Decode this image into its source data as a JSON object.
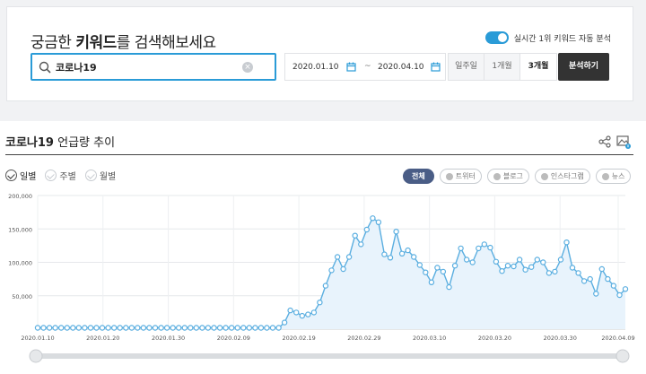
{
  "search": {
    "title_prefix": "궁금한 ",
    "title_bold": "키워드",
    "title_suffix": "를 검색해보세요",
    "keyword": "코로나19",
    "icon": "search-icon",
    "clear_icon": "close-icon"
  },
  "realtime_toggle": {
    "label": "실시간 1위 키워드 자동 분석",
    "on": true,
    "color": "#2a9bd7"
  },
  "date_range": {
    "start": "2020.01.10",
    "end": "2020.04.10",
    "separator": "~"
  },
  "period_options": [
    "일주일",
    "1개월",
    "3개월"
  ],
  "period_selected": "3개월",
  "analyze_button": "분석하기",
  "trend": {
    "keyword": "코로나19",
    "title_suffix": " 언급량 추이",
    "granularity": [
      "일별",
      "주별",
      "월별"
    ],
    "granularity_selected": "일별",
    "sources": [
      "전체",
      "트위터",
      "블로그",
      "인스타그램",
      "뉴스"
    ],
    "source_selected": "전체"
  },
  "colors": {
    "accent": "#2a9bd7",
    "selected_source": "#4a5d86",
    "line": "#5aaee0",
    "area": "#e8f3fc"
  },
  "chart_data": {
    "type": "line",
    "x_ticks": [
      "2020.01.10",
      "2020.01.20",
      "2020.01.30",
      "2020.02.09",
      "2020.02.19",
      "2020.02.29",
      "2020.03.10",
      "2020.03.20",
      "2020.03.30",
      "2020.04.09"
    ],
    "y_ticks": [
      "200,000",
      "150,000",
      "100,000",
      "50,000"
    ],
    "ylim": [
      0,
      200000
    ],
    "x_start": "2020.01.10",
    "x_end": "2020.04.10",
    "values": [
      2000,
      2000,
      2000,
      2000,
      2000,
      2000,
      2000,
      2000,
      2000,
      2000,
      2000,
      2000,
      2000,
      2000,
      2000,
      2000,
      2000,
      2000,
      2000,
      2000,
      2000,
      2000,
      2000,
      2000,
      2000,
      2000,
      2000,
      2000,
      2000,
      2000,
      2000,
      2000,
      2000,
      2000,
      2000,
      2000,
      2000,
      2000,
      2000,
      2000,
      2000,
      2000,
      10000,
      28000,
      25000,
      20000,
      22000,
      25000,
      40000,
      65000,
      88000,
      108000,
      90000,
      108000,
      140000,
      127000,
      149000,
      166000,
      160000,
      112000,
      107000,
      146000,
      113000,
      118000,
      108000,
      96000,
      85000,
      70000,
      92000,
      86000,
      63000,
      95000,
      121000,
      104000,
      100000,
      121000,
      127000,
      122000,
      101000,
      87000,
      95000,
      94000,
      104000,
      89000,
      93000,
      104000,
      100000,
      84000,
      86000,
      104000,
      130000,
      92000,
      84000,
      72000,
      75000,
      53000,
      90000,
      75000,
      65000,
      51000,
      60000
    ],
    "grid": true,
    "legend": "none"
  }
}
